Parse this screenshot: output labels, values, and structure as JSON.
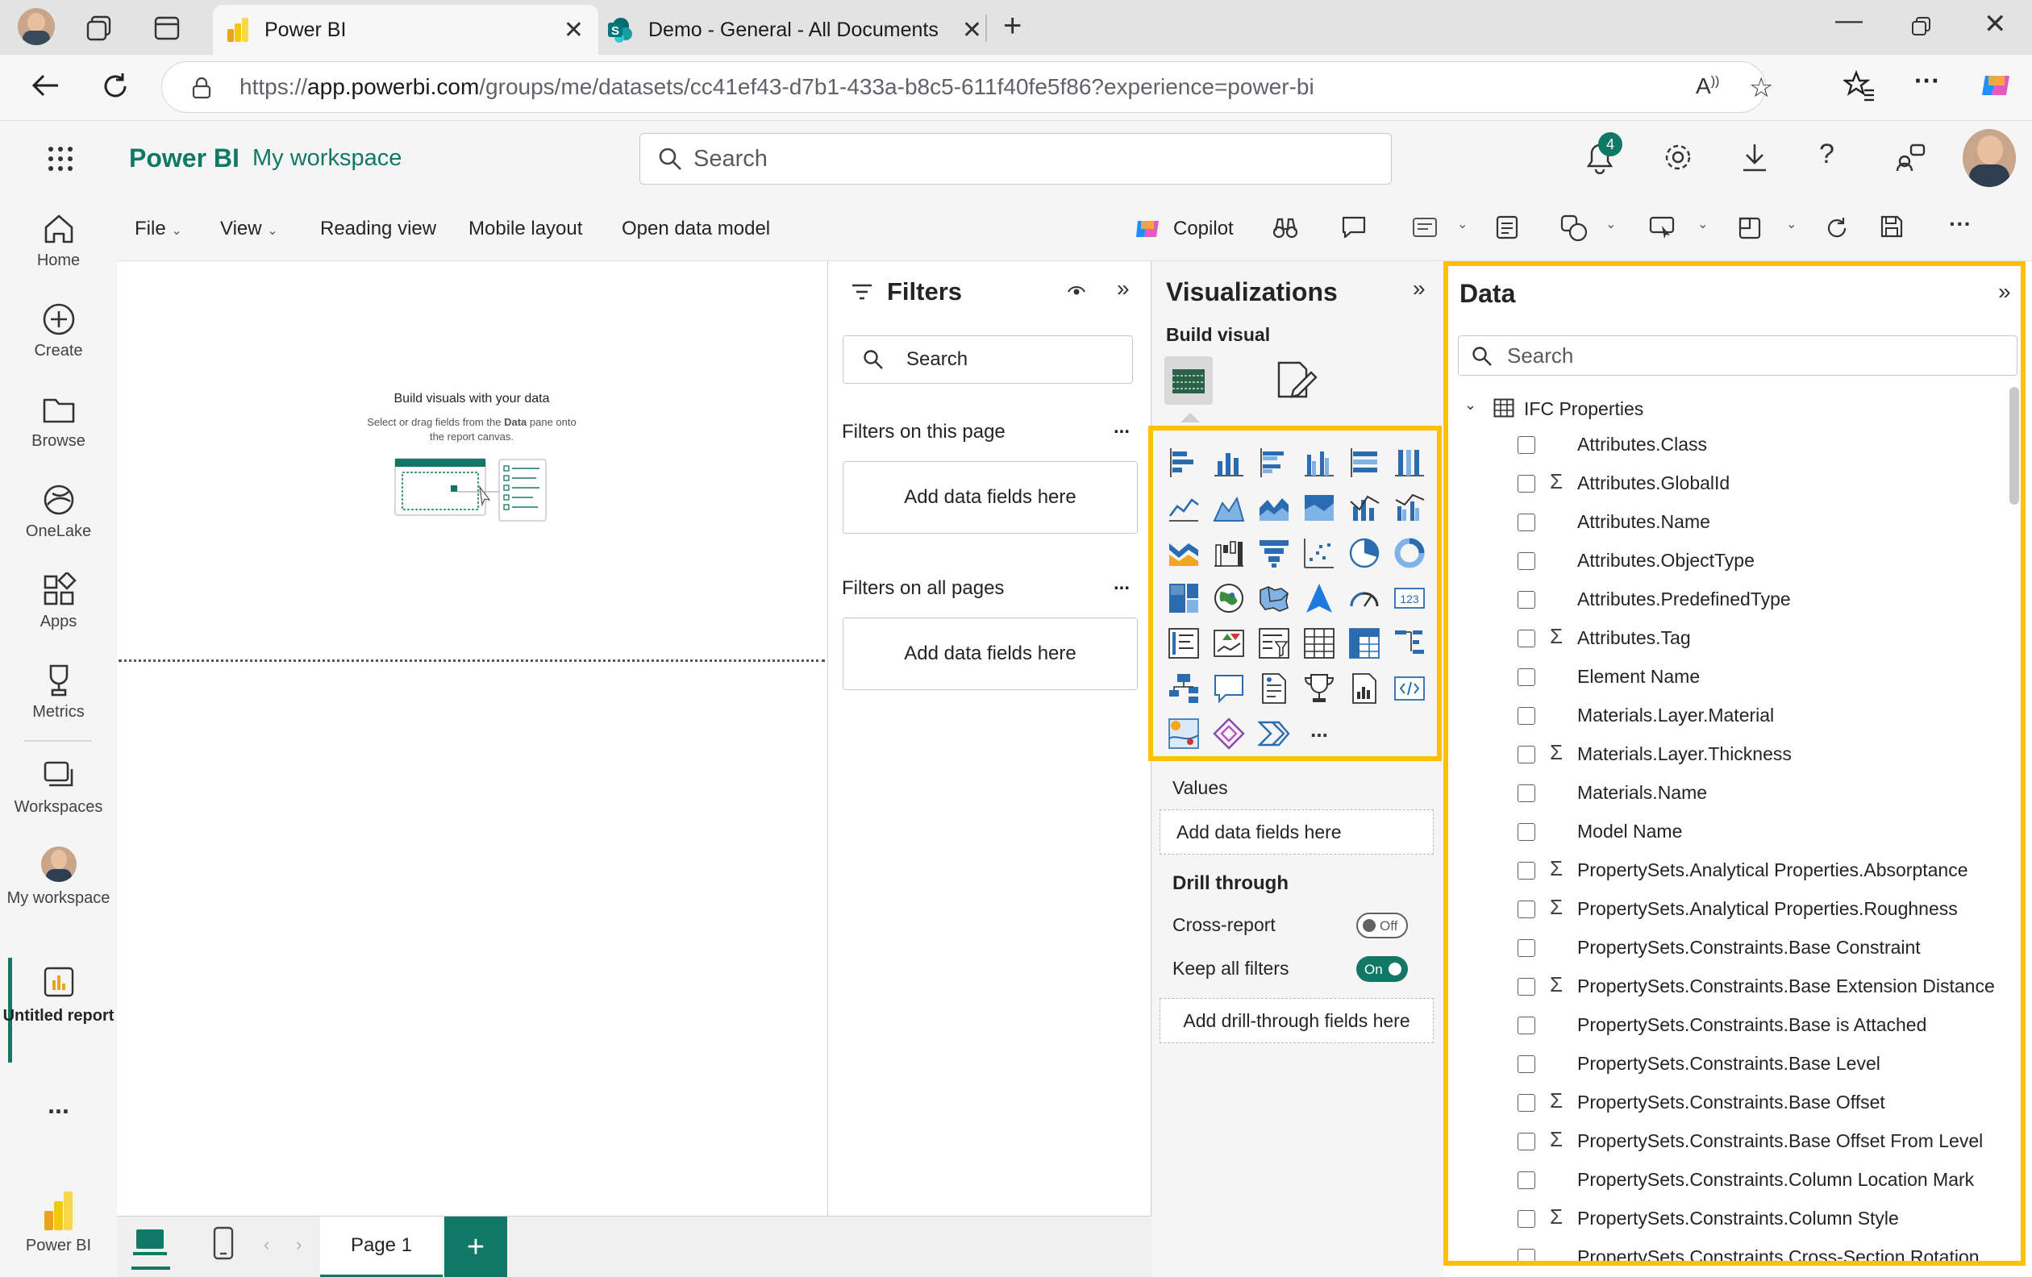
{
  "browser": {
    "tabs": [
      {
        "title": "Power BI",
        "active": true
      },
      {
        "title": "Demo - General - All Documents",
        "active": false
      }
    ],
    "url_prefix": "https://",
    "url_host": "app.powerbi.com",
    "url_path": "/groups/me/datasets/cc41ef43-d7b1-433a-b8c5-611f40fe5f86?experience=power-bi"
  },
  "header": {
    "brand": "Power BI",
    "workspace": "My workspace",
    "search_placeholder": "Search",
    "notification_count": "4"
  },
  "leftnav": {
    "items": [
      {
        "label": "Home",
        "icon": "home-icon"
      },
      {
        "label": "Create",
        "icon": "plus-circle-icon"
      },
      {
        "label": "Browse",
        "icon": "folder-icon"
      },
      {
        "label": "OneLake",
        "icon": "onelake-icon"
      },
      {
        "label": "Apps",
        "icon": "apps-icon"
      },
      {
        "label": "Metrics",
        "icon": "trophy-icon"
      },
      {
        "label": "Workspaces",
        "icon": "workspaces-icon"
      },
      {
        "label": "My workspace",
        "icon": "avatar"
      },
      {
        "label": "Untitled report",
        "icon": "report-icon"
      }
    ],
    "more": "...",
    "footer": "Power BI"
  },
  "ribbon": {
    "file": "File",
    "view": "View",
    "reading_view": "Reading view",
    "mobile_layout": "Mobile layout",
    "open_data_model": "Open data model",
    "copilot": "Copilot"
  },
  "canvas": {
    "empty_title": "Build visuals with your data",
    "empty_line1": "Select or drag fields from the",
    "empty_bold": "Data",
    "empty_line1b": "pane onto",
    "empty_line2": "the report canvas."
  },
  "pages": {
    "current": "Page 1",
    "add": "+"
  },
  "filters": {
    "title": "Filters",
    "search_placeholder": "Search",
    "this_page": "Filters on this page",
    "all_pages": "Filters on all pages",
    "add_fields": "Add data fields here",
    "more": "..."
  },
  "visualizations": {
    "title": "Visualizations",
    "build_visual": "Build visual",
    "values": "Values",
    "add_fields": "Add data fields here",
    "drill_through": "Drill through",
    "cross_report": "Cross-report",
    "cross_report_state": "Off",
    "keep_all_filters": "Keep all filters",
    "keep_all_filters_state": "On",
    "add_drill": "Add drill-through fields here",
    "more": "..."
  },
  "data": {
    "title": "Data",
    "search_placeholder": "Search",
    "table_name": "IFC Properties",
    "fields": [
      {
        "name": "Attributes.Class",
        "sigma": false
      },
      {
        "name": "Attributes.GlobalId",
        "sigma": true
      },
      {
        "name": "Attributes.Name",
        "sigma": false
      },
      {
        "name": "Attributes.ObjectType",
        "sigma": false
      },
      {
        "name": "Attributes.PredefinedType",
        "sigma": false
      },
      {
        "name": "Attributes.Tag",
        "sigma": true
      },
      {
        "name": "Element Name",
        "sigma": false
      },
      {
        "name": "Materials.Layer.Material",
        "sigma": false
      },
      {
        "name": "Materials.Layer.Thickness",
        "sigma": true
      },
      {
        "name": "Materials.Name",
        "sigma": false
      },
      {
        "name": "Model Name",
        "sigma": false
      },
      {
        "name": "PropertySets.Analytical Properties.Absorptance",
        "sigma": true
      },
      {
        "name": "PropertySets.Analytical Properties.Roughness",
        "sigma": true
      },
      {
        "name": "PropertySets.Constraints.Base Constraint",
        "sigma": false
      },
      {
        "name": "PropertySets.Constraints.Base Extension Distance",
        "sigma": true
      },
      {
        "name": "PropertySets.Constraints.Base is Attached",
        "sigma": false
      },
      {
        "name": "PropertySets.Constraints.Base Level",
        "sigma": false
      },
      {
        "name": "PropertySets.Constraints.Base Offset",
        "sigma": true
      },
      {
        "name": "PropertySets.Constraints.Base Offset From Level",
        "sigma": true
      },
      {
        "name": "PropertySets.Constraints.Column Location Mark",
        "sigma": false
      },
      {
        "name": "PropertySets.Constraints.Column Style",
        "sigma": true
      },
      {
        "name": "PropertySets.Constraints.Cross-Section Rotation",
        "sigma": false
      }
    ]
  },
  "colors": {
    "brand_green": "#117865",
    "highlight": "#ffc000",
    "viz_blue": "#2b6cb0"
  }
}
